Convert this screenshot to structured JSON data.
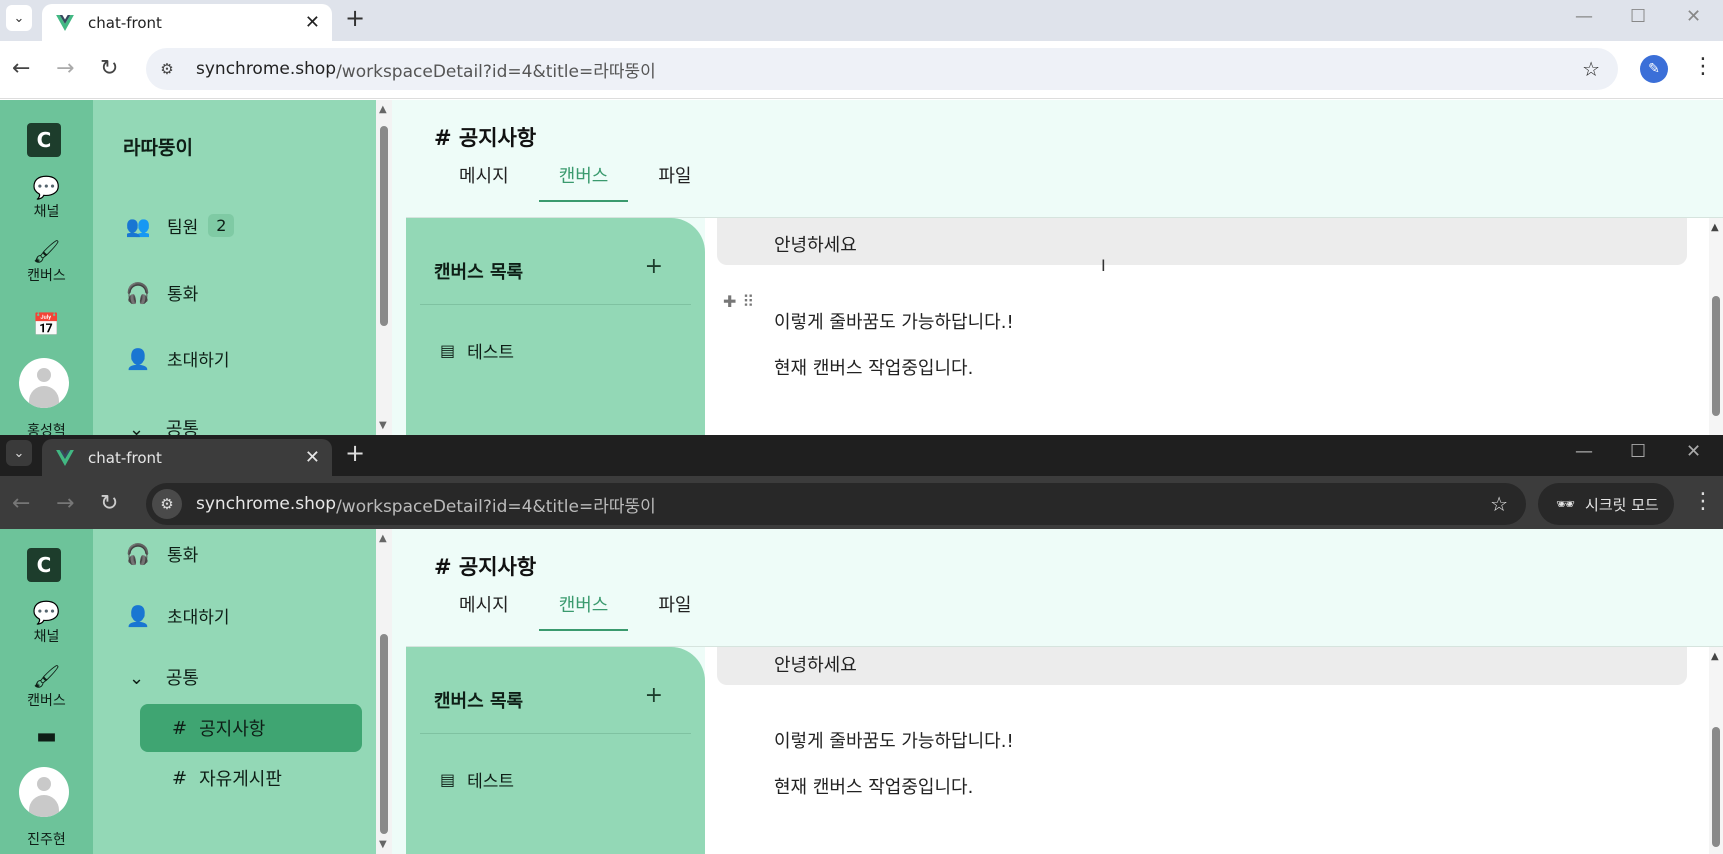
{
  "browser": {
    "tab_title": "chat-front",
    "url_host": "synchrome.shop",
    "url_path": "/workspaceDetail?id=4&title=라따뚱이",
    "incognito_label": "시크릿 모드"
  },
  "rail": {
    "logo": "C",
    "items": [
      {
        "label": "채널",
        "icon": "chat-bubble-icon"
      },
      {
        "label": "캔버스",
        "icon": "brush-icon"
      }
    ],
    "user_top": "홍성혁",
    "user_bottom": "진주현"
  },
  "sidebar": {
    "workspace": "라따뚱이",
    "members_label": "팀원",
    "members_count": "2",
    "call_label": "통화",
    "invite_label": "초대하기",
    "group_label": "공통",
    "channels": [
      "공지사항",
      "자유게시판"
    ],
    "hash": "#"
  },
  "main": {
    "channel_title": "# 공지사항",
    "tabs": [
      "메시지",
      "캔버스",
      "파일"
    ],
    "active_tab": "캔버스"
  },
  "canvas": {
    "list_title": "캔버스 목록",
    "add": "+",
    "items": [
      "테스트"
    ]
  },
  "editor": {
    "lines": [
      "안녕하세요",
      "이렇게 줄바꿈도 가능하답니다.!",
      "현재 캔버스 작업중입니다."
    ]
  }
}
